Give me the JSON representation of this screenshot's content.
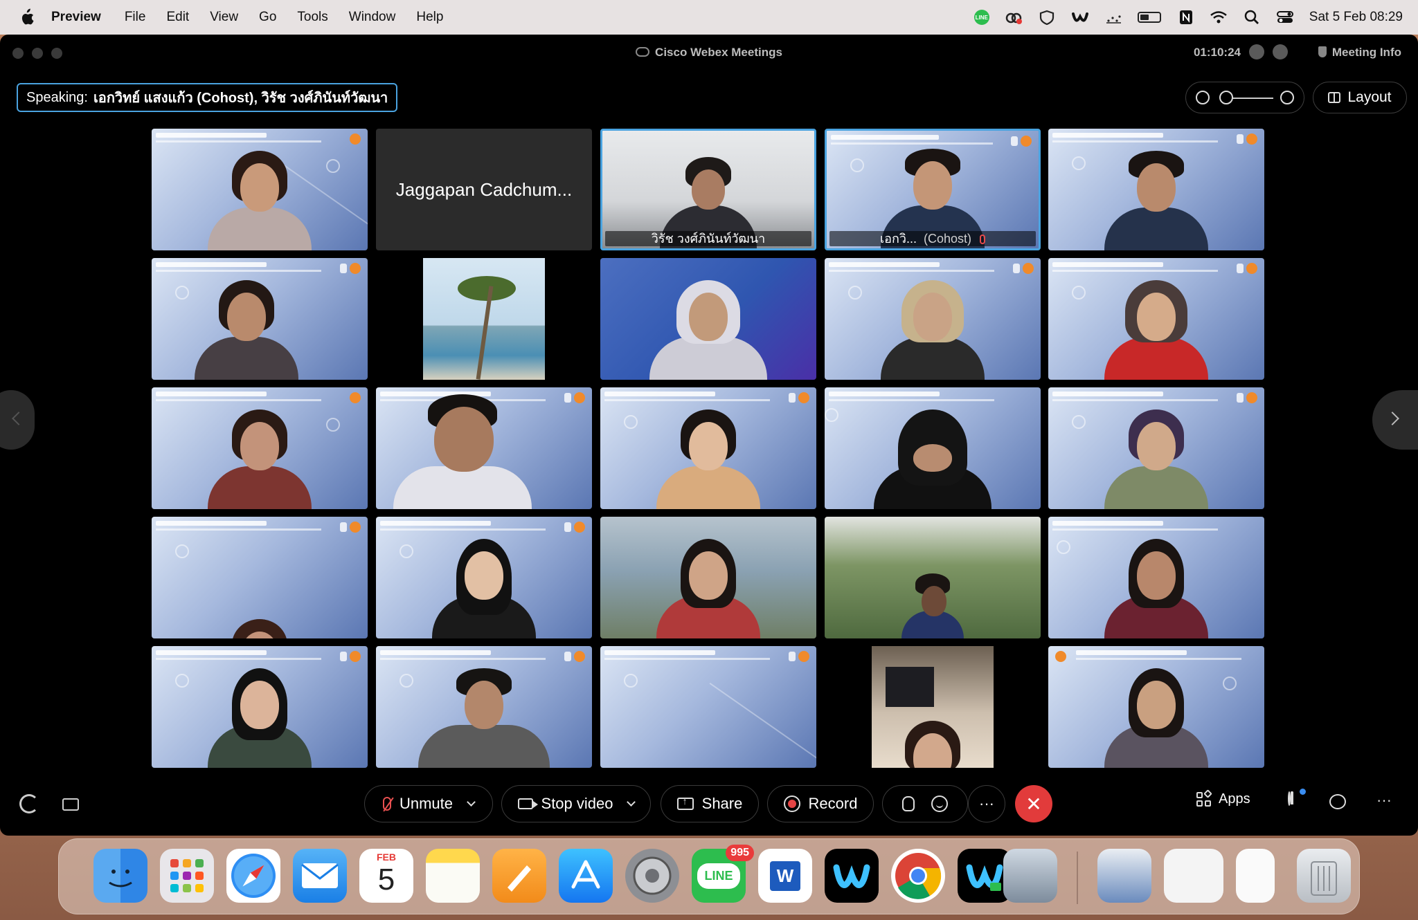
{
  "menubar": {
    "app_name": "Preview",
    "items": [
      "File",
      "Edit",
      "View",
      "Go",
      "Tools",
      "Window",
      "Help"
    ],
    "clock": "Sat 5 Feb  08:29",
    "line_icon_text": "LINE"
  },
  "window": {
    "title": "Cisco Webex Meetings",
    "timer": "01:10:24",
    "meeting_info": "Meeting Info"
  },
  "speaking": {
    "label": "Speaking:",
    "names": "เอกวิทย์ แสงแก้ว (Cohost),  วิรัช วงศ์ภินันท์วัฒนา"
  },
  "layout_button": "Layout",
  "tiles": {
    "jaggapan": "Jaggapan Cadchum...",
    "wirat": "วิรัช วงศ์ภินันท์วัฒนา",
    "ekawit": "เอกวิ...",
    "ekawit_role": "(Cohost)"
  },
  "controls": {
    "unmute": "Unmute",
    "stop_video": "Stop video",
    "share": "Share",
    "record": "Record",
    "more": "···",
    "end": "✕",
    "apps": "Apps",
    "more_options": "···"
  },
  "dock": {
    "calendar_month": "FEB",
    "calendar_day": "5",
    "line_badge": "995",
    "line_label": "LINE",
    "word_label": "W"
  },
  "colors": {
    "accent": "#4aa3e0",
    "end_call": "#e23b3b",
    "mute_red": "#e85050",
    "webex_bg": "#000000"
  }
}
